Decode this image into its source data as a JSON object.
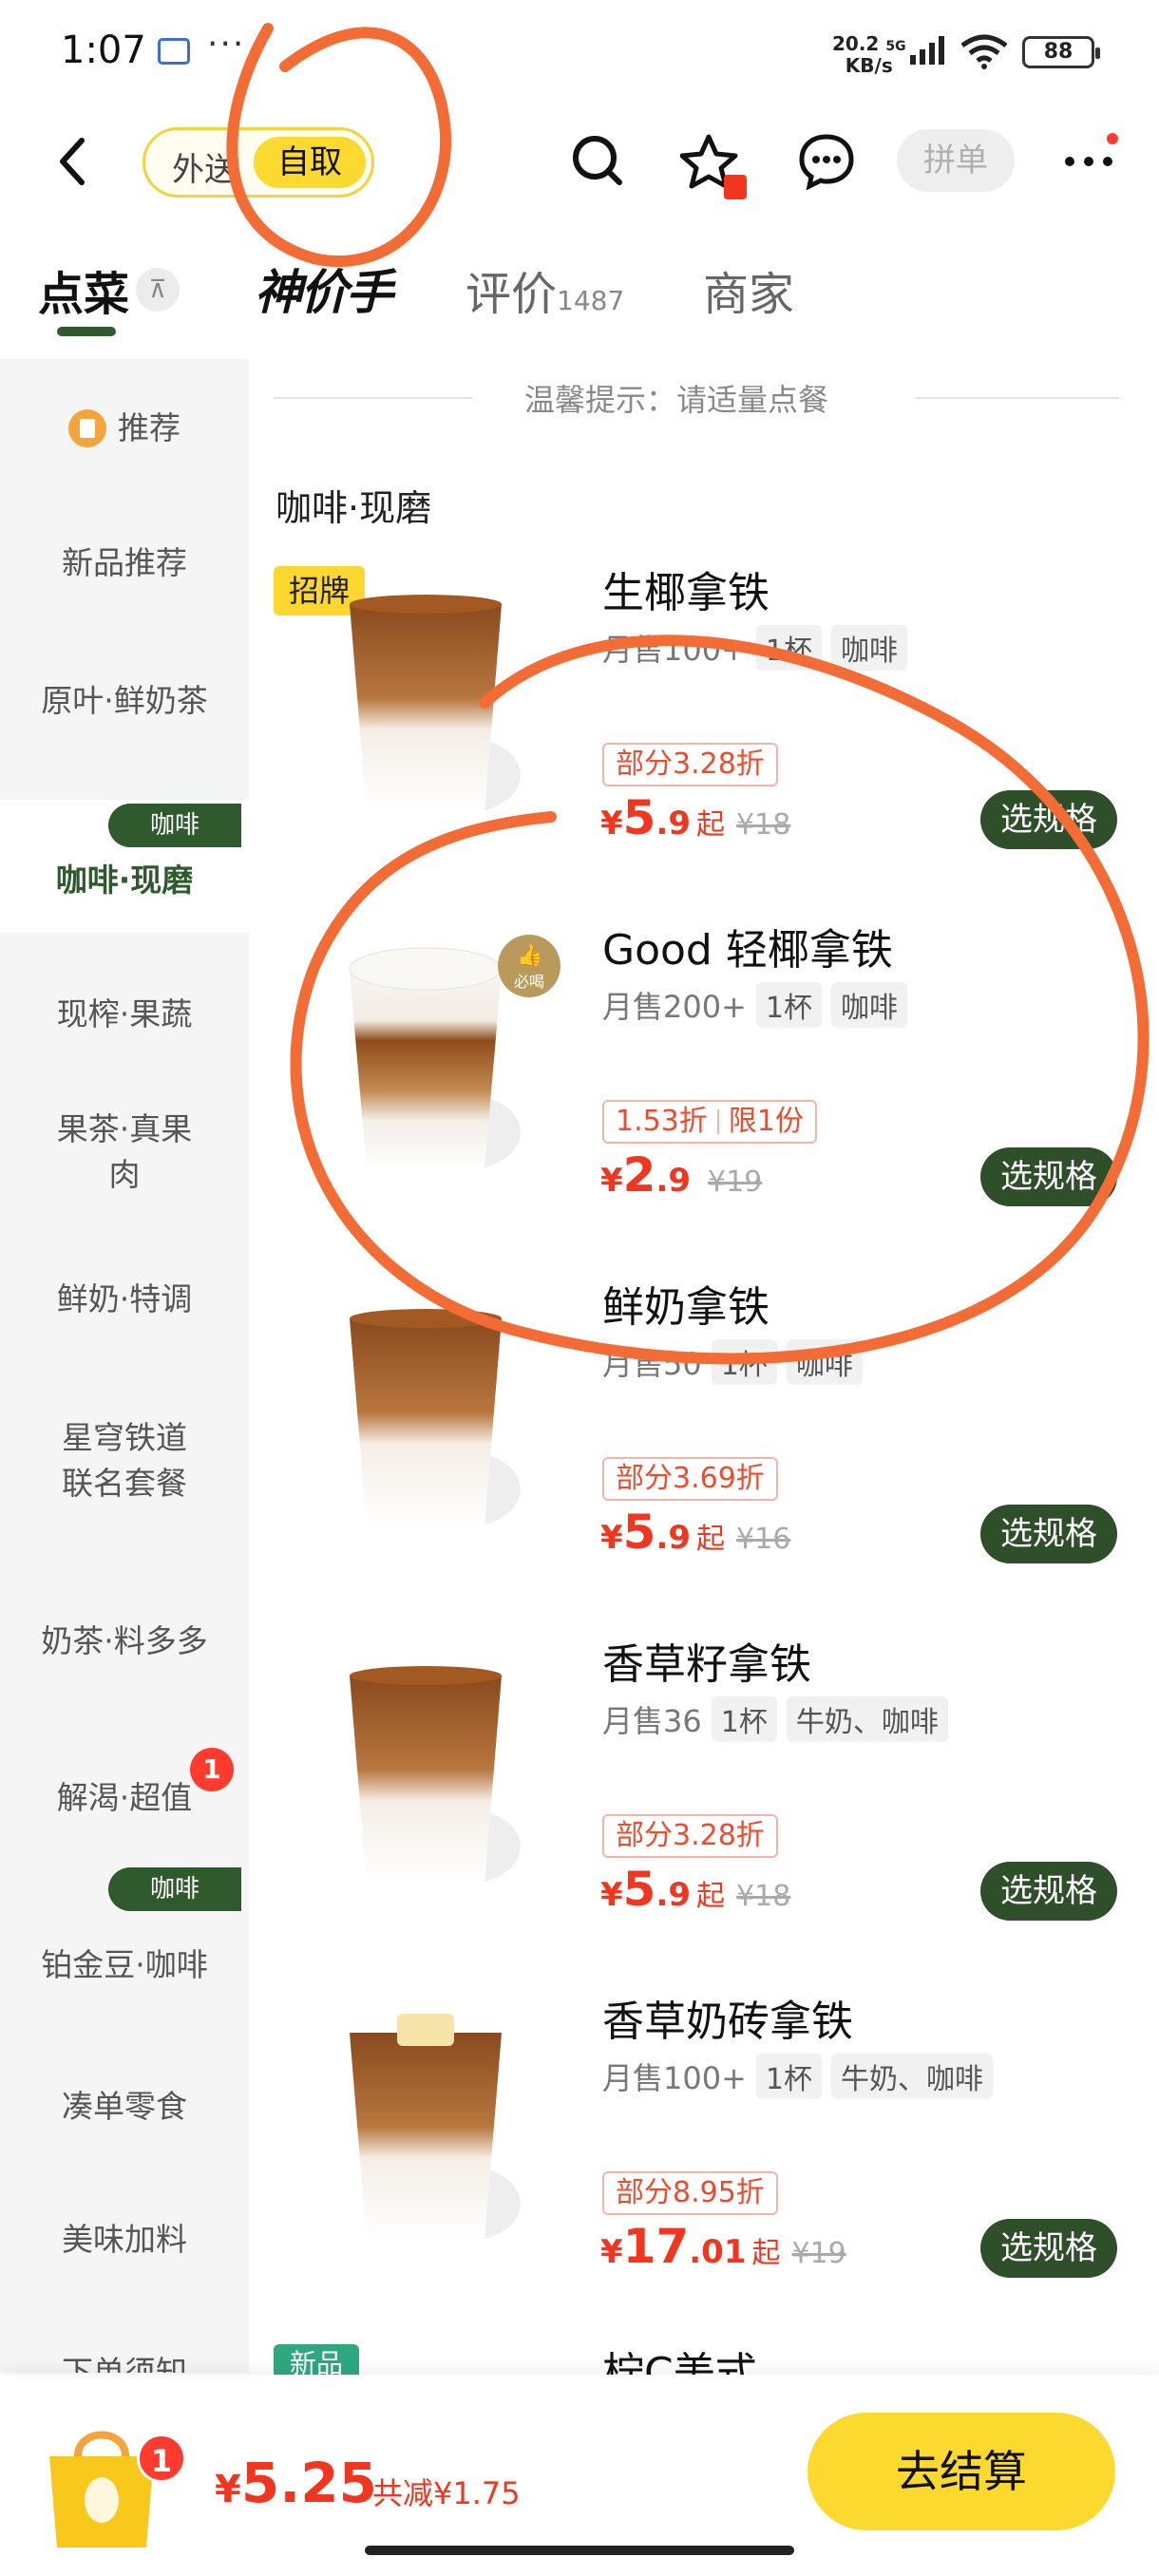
{
  "status_bar": {
    "time": "1:07",
    "dots": "···",
    "net_speed": "20.2",
    "net_unit": "KB/s",
    "net_type": "5G",
    "battery": "88"
  },
  "header": {
    "mode_delivery": "外送",
    "mode_pickup": "自取",
    "group_order": "拼单"
  },
  "tabs": {
    "order": "点菜",
    "brand": "神价手",
    "reviews": "评价",
    "reviews_count": "1487",
    "merchant": "商家",
    "collapse_icon": "⊼"
  },
  "tip": "温馨提示：请适量点餐",
  "section_title": "咖啡·现磨",
  "sidebar": {
    "items": [
      {
        "label": "推荐"
      },
      {
        "label": "新品推荐"
      },
      {
        "label": "原叶·鲜奶茶"
      },
      {
        "label": "咖啡·现磨",
        "tag": "咖啡"
      },
      {
        "label": "现榨·果蔬"
      },
      {
        "label": "果茶·真果肉"
      },
      {
        "label": "鲜奶·特调"
      },
      {
        "label": "星穹铁道联名套餐"
      },
      {
        "label": "奶茶·料多多"
      },
      {
        "label": "解渴·超值",
        "badge": "1"
      },
      {
        "label": "铂金豆·咖啡",
        "tag": "咖啡"
      },
      {
        "label": "凑单零食"
      },
      {
        "label": "美味加料"
      },
      {
        "label": "下单须知"
      }
    ]
  },
  "products": [
    {
      "name": "生椰拿铁",
      "badge": "招牌",
      "sales": "月售100+",
      "size": "1杯",
      "category": "咖啡",
      "discount": "部分3.28折",
      "price_int": "5",
      "price_dec": ".9",
      "from": "起",
      "old_price": "¥18",
      "button": "选规格"
    },
    {
      "name": "Good 轻椰拿铁",
      "must_badge": "必喝",
      "sales": "月售200+",
      "size": "1杯",
      "category": "咖啡",
      "discount": "1.53折",
      "limit": "限1份",
      "price_int": "2",
      "price_dec": ".9",
      "from": "",
      "old_price": "¥19",
      "button": "选规格"
    },
    {
      "name": "鲜奶拿铁",
      "sales": "月售50",
      "size": "1杯",
      "category": "咖啡",
      "discount": "部分3.69折",
      "price_int": "5",
      "price_dec": ".9",
      "from": "起",
      "old_price": "¥16",
      "button": "选规格"
    },
    {
      "name": "香草籽拿铁",
      "sales": "月售36",
      "size": "1杯",
      "category": "牛奶、咖啡",
      "discount": "部分3.28折",
      "price_int": "5",
      "price_dec": ".9",
      "from": "起",
      "old_price": "¥18",
      "button": "选规格"
    },
    {
      "name": "香草奶砖拿铁",
      "sales": "月售100+",
      "size": "1杯",
      "category": "牛奶、咖啡",
      "discount": "部分8.95折",
      "price_int": "17",
      "price_dec": ".01",
      "from": "起",
      "old_price": "¥19",
      "button": "选规格"
    },
    {
      "name": "柠C美式",
      "badge_new": "新品"
    }
  ],
  "cart": {
    "count": "1",
    "total": "5.25",
    "saved": "共减¥1.75",
    "checkout": "去结算"
  },
  "colors": {
    "brand_green": "#2f4f2a",
    "accent_yellow": "#fbd92f",
    "price_red": "#f0361e",
    "annotation_orange": "#f36b35"
  }
}
